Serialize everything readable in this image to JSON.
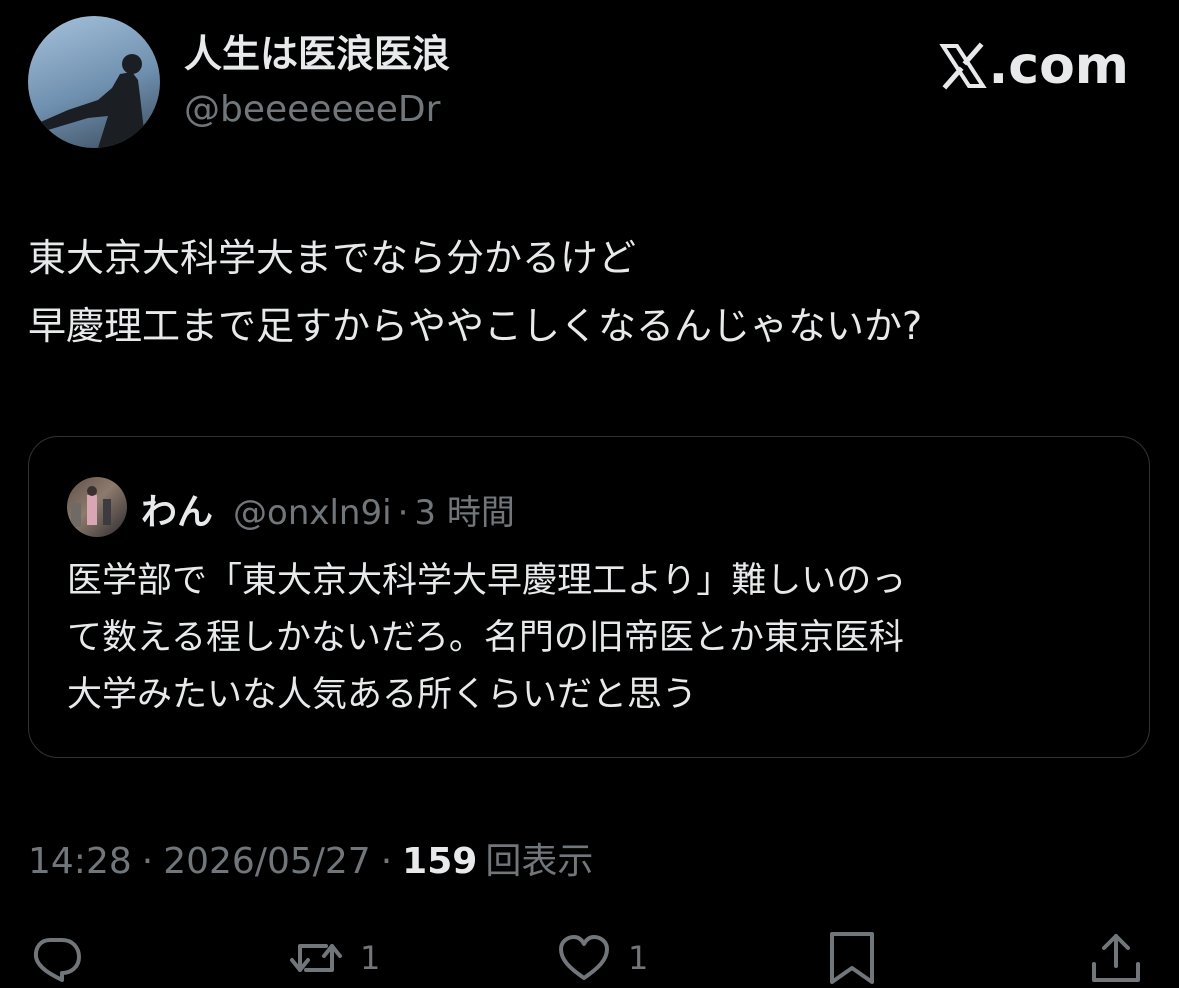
{
  "author": {
    "display_name": "人生は医浪医浪",
    "handle": "@beeeeeeeDr",
    "avatar_icon": "avatar-photo-statue"
  },
  "brand": {
    "label": ".com",
    "icon": "x-logo-icon"
  },
  "tweet": {
    "lines": [
      "東大京大科学大までなら分かるけど",
      "早慶理工まで足すからややこしくなるんじゃないか?"
    ]
  },
  "quote": {
    "display_name": "わん",
    "handle": "@onxln9i",
    "separator": "·",
    "time": "3 時間",
    "avatar_icon": "avatar-photo",
    "lines": [
      "医学部で「東大京大科学大早慶理工より」難しいのっ",
      "て数える程しかないだろ。名門の旧帝医とか東京医科",
      "大学みたいな人気ある所くらいだと思う"
    ]
  },
  "meta": {
    "time": "14:28",
    "separator": "·",
    "date": "2026/05/27",
    "views_count": "159",
    "views_label": "回表示"
  },
  "actions": {
    "reply": {
      "icon": "reply-icon",
      "count": ""
    },
    "repost": {
      "icon": "repost-icon",
      "count": "1"
    },
    "like": {
      "icon": "heart-icon",
      "count": "1"
    },
    "bookmark": {
      "icon": "bookmark-icon",
      "count": ""
    },
    "share": {
      "icon": "share-icon",
      "count": ""
    }
  },
  "colors": {
    "background": "#000000",
    "text_primary": "#e7e9ea",
    "text_secondary": "#71767b",
    "border": "#2f3336"
  }
}
